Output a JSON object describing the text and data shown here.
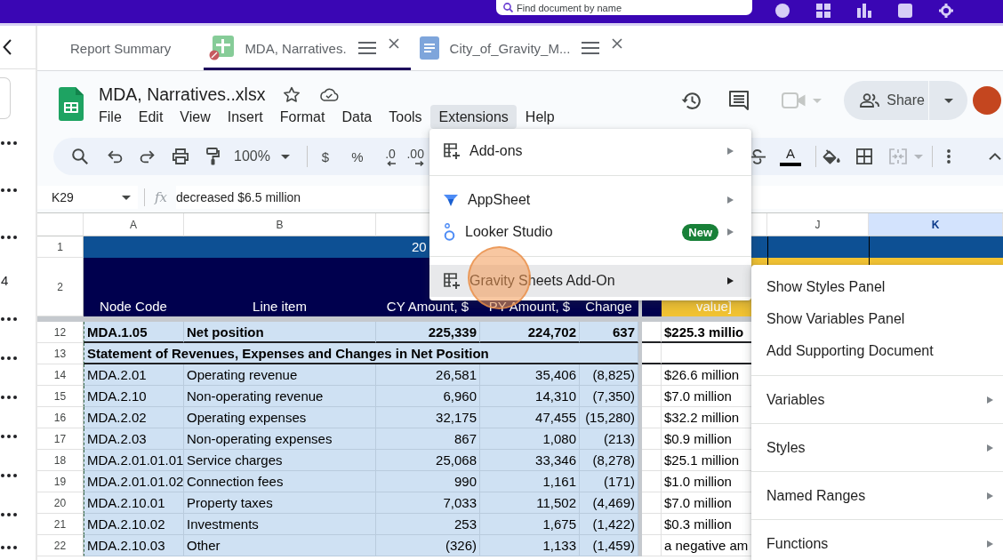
{
  "top_bar": {
    "search": {
      "placeholder": "Find document by name"
    }
  },
  "sidebar": {
    "rows": [
      {
        "kind": "more"
      },
      {
        "kind": "more"
      },
      {
        "kind": "more"
      },
      {
        "kind": "text",
        "text": "4"
      },
      {
        "kind": "more"
      },
      {
        "kind": "more"
      },
      {
        "kind": "more"
      },
      {
        "kind": "more"
      },
      {
        "kind": "more"
      },
      {
        "kind": "more"
      },
      {
        "kind": "more"
      }
    ]
  },
  "tabs": [
    {
      "label": "Report Summary",
      "kind": "plain",
      "selected": false
    },
    {
      "label": "MDA, Narratives.",
      "kind": "sheet",
      "selected": true
    },
    {
      "label": "City_of_Gravity_M...",
      "kind": "doc",
      "selected": false
    }
  ],
  "document": {
    "title": "MDA, Narratives..xlsx",
    "menu": [
      {
        "label": "File",
        "selected": false
      },
      {
        "label": "Edit",
        "selected": false
      },
      {
        "label": "View",
        "selected": false
      },
      {
        "label": "Insert",
        "selected": false
      },
      {
        "label": "Format",
        "selected": false
      },
      {
        "label": "Data",
        "selected": false
      },
      {
        "label": "Tools",
        "selected": false
      },
      {
        "label": "Extensions",
        "selected": true
      },
      {
        "label": "Help",
        "selected": false
      }
    ],
    "share": {
      "label": "Share"
    }
  },
  "toolbar": {
    "zoom": "100%",
    "number_formats": [
      {
        "label": "$",
        "kind": "plain"
      },
      {
        "label": "%",
        "kind": "plain"
      },
      {
        "label": ".0",
        "kind": "decrease"
      },
      {
        "label": ".00",
        "kind": "increase"
      }
    ],
    "text_color": {
      "label": "A"
    }
  },
  "formula_bar": {
    "cell": "K29",
    "symbol": "fx",
    "formula": "decreased $6.5 million"
  },
  "sheet": {
    "column_headers": {
      "left": [
        {
          "label": "A",
          "selected": false
        },
        {
          "label": "B",
          "selected": false
        }
      ],
      "right": [
        {
          "label": "J",
          "selected": false
        },
        {
          "label": "K",
          "selected": true
        }
      ]
    },
    "header_rows": [
      {
        "number": "1",
        "kind": "banner",
        "text": "20"
      },
      {
        "number": "2",
        "kind": "labels",
        "cells": [
          "Node Code",
          "Line item",
          "CY Amount, $",
          "PY Amount, $",
          "Change"
        ],
        "value": "value]"
      }
    ],
    "rows": [
      {
        "number": "12",
        "kind": "total",
        "selected": true,
        "cells": [
          "MDA.1.05",
          "Net position",
          "225,339",
          "224,702",
          "637"
        ],
        "value": "$225.3 millio"
      },
      {
        "number": "13",
        "kind": "section",
        "selected": true,
        "title": "Statement of Revenues, Expenses and Changes in Net Position"
      },
      {
        "number": "14",
        "kind": "data",
        "selected": true,
        "cells": [
          "MDA.2.01",
          "Operating revenue",
          "26,581",
          "35,406",
          "(8,825)"
        ],
        "value": "$26.6 million"
      },
      {
        "number": "15",
        "kind": "data",
        "selected": true,
        "cells": [
          "MDA.2.10",
          "Non-operating revenue",
          "6,960",
          "14,310",
          "(7,350)"
        ],
        "value": "$7.0 million"
      },
      {
        "number": "16",
        "kind": "data",
        "selected": true,
        "cells": [
          "MDA.2.02",
          "Operating expenses",
          "32,175",
          "47,455",
          "(15,280)"
        ],
        "value": "$32.2 million"
      },
      {
        "number": "17",
        "kind": "data",
        "selected": true,
        "cells": [
          "MDA.2.03",
          "Non-operating expenses",
          "867",
          "1,080",
          "(213)"
        ],
        "value": "$0.9 million"
      },
      {
        "number": "18",
        "kind": "data",
        "selected": true,
        "cells": [
          "MDA.2.01.01.01",
          "Service charges",
          "25,068",
          "33,346",
          "(8,278)"
        ],
        "value": "$25.1 million"
      },
      {
        "number": "19",
        "kind": "data",
        "selected": true,
        "cells": [
          "MDA.2.01.01.02",
          "Connection fees",
          "990",
          "1,161",
          "(171)"
        ],
        "value": "$1.0 million"
      },
      {
        "number": "20",
        "kind": "data",
        "selected": true,
        "cells": [
          "MDA.2.10.01",
          "Property taxes",
          "7,033",
          "11,502",
          "(4,469)"
        ],
        "value": "$7.0 million"
      },
      {
        "number": "21",
        "kind": "data",
        "selected": true,
        "cells": [
          "MDA.2.10.02",
          "Investments",
          "253",
          "1,675",
          "(1,422)"
        ],
        "value": "$0.3 million"
      },
      {
        "number": "22",
        "kind": "data",
        "selected": true,
        "cells": [
          "MDA.2.10.03",
          "Other",
          "(326)",
          "1,133",
          "(1,459)"
        ],
        "value": "a negative am"
      }
    ]
  },
  "extensions_menu": {
    "groups": [
      {
        "items": [
          {
            "label": "Add-ons",
            "kind": "addon",
            "submenu": true,
            "selected": false
          }
        ]
      },
      {
        "items": [
          {
            "label": "AppSheet",
            "kind": "appsheet",
            "submenu": true,
            "selected": false
          },
          {
            "label": "Looker Studio",
            "kind": "looker",
            "badge": "New",
            "submenu": true,
            "selected": false
          }
        ]
      },
      {
        "items": [
          {
            "label": "Gravity Sheets Add-On",
            "kind": "addon",
            "submenu": true,
            "selected": true
          }
        ]
      }
    ]
  },
  "addon_submenu": {
    "groups": [
      {
        "items": [
          {
            "label": "Show Styles Panel",
            "submenu": false,
            "selected": false
          },
          {
            "label": "Show Variables Panel",
            "submenu": false,
            "selected": false
          },
          {
            "label": "Add Supporting Document",
            "submenu": false,
            "selected": false
          }
        ]
      },
      {
        "items": [
          {
            "label": "Variables",
            "submenu": true,
            "selected": false
          }
        ]
      },
      {
        "items": [
          {
            "label": "Styles",
            "submenu": true,
            "selected": false
          }
        ]
      },
      {
        "items": [
          {
            "label": "Named Ranges",
            "submenu": true,
            "selected": false
          }
        ]
      },
      {
        "items": [
          {
            "label": "Functions",
            "submenu": true,
            "selected": false
          }
        ]
      }
    ]
  }
}
